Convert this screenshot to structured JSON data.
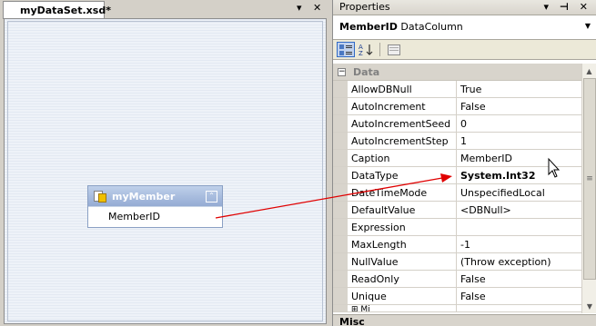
{
  "designer": {
    "tab_label": "myDataSet.xsd*",
    "dropdown_glyph": "▾",
    "close_glyph": "✕",
    "table": {
      "name": "myMember",
      "collapse_glyph": "⌃",
      "columns": [
        "MemberID"
      ]
    }
  },
  "properties": {
    "title": "Properties",
    "title_buttons": "▾ ⊣ ✕",
    "object": {
      "name": "MemberID",
      "type": "DataColumn",
      "dropdown_glyph": "▼"
    },
    "toolbar": {
      "categorized_icon": "categorized-icon",
      "alphabetical_icon": "alphabetical-icon",
      "property_pages_icon": "property-pages-icon"
    },
    "category": {
      "toggle": "−",
      "label": "Data"
    },
    "rows": [
      {
        "name": "AllowDBNull",
        "value": "True",
        "bold": false
      },
      {
        "name": "AutoIncrement",
        "value": "False",
        "bold": false
      },
      {
        "name": "AutoIncrementSeed",
        "value": "0",
        "bold": false
      },
      {
        "name": "AutoIncrementStep",
        "value": "1",
        "bold": false
      },
      {
        "name": "Caption",
        "value": "MemberID",
        "bold": false
      },
      {
        "name": "DataType",
        "value": "System.Int32",
        "bold": true
      },
      {
        "name": "DateTimeMode",
        "value": "UnspecifiedLocal",
        "bold": false
      },
      {
        "name": "DefaultValue",
        "value": "<DBNull>",
        "bold": false
      },
      {
        "name": "Expression",
        "value": "",
        "bold": false
      },
      {
        "name": "MaxLength",
        "value": "-1",
        "bold": false
      },
      {
        "name": "NullValue",
        "value": "(Throw exception)",
        "bold": false
      },
      {
        "name": "ReadOnly",
        "value": "False",
        "bold": false
      },
      {
        "name": "Unique",
        "value": "False",
        "bold": false
      }
    ],
    "partial_row": "⊞ Mi",
    "description_title": "Misc",
    "scrollbar": {
      "up": "▲",
      "down": "▼",
      "grip": "≡"
    }
  },
  "colors": {
    "annotation_arrow": "#e00000",
    "table_header": "#94abd3",
    "category_text": "#808080"
  }
}
